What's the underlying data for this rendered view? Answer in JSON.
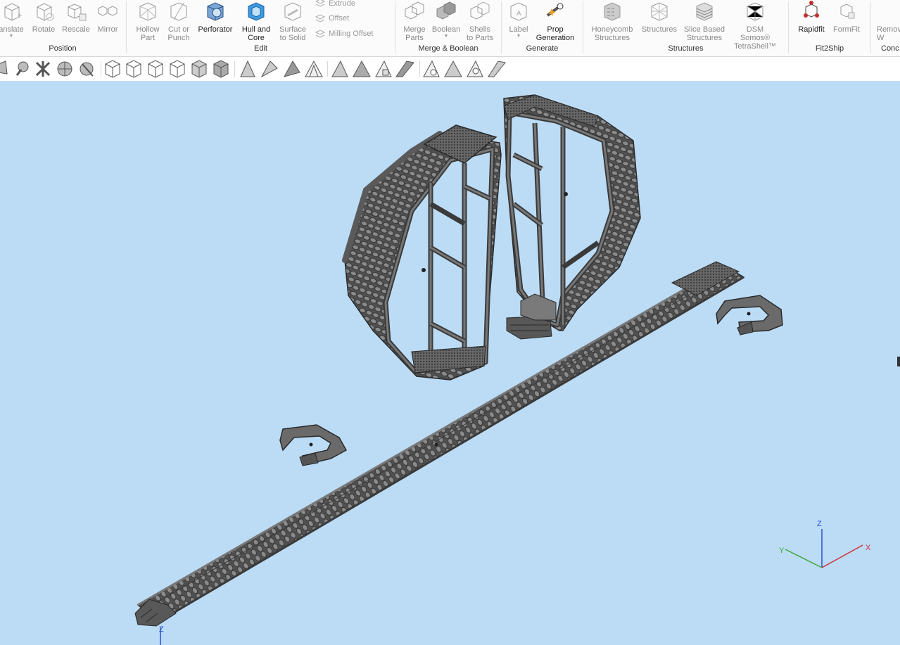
{
  "ribbon": {
    "groups": [
      {
        "label": "Position",
        "buttons": [
          {
            "label": "anslate",
            "dropdown": true
          },
          {
            "label": "Rotate"
          },
          {
            "label": "Rescale"
          },
          {
            "label": "Mirror"
          }
        ]
      },
      {
        "label": "Edit",
        "buttons": [
          {
            "label": "Hollow\nPart"
          },
          {
            "label": "Cut or\nPunch"
          },
          {
            "label": "Perforator"
          },
          {
            "label": "Hull and\nCore"
          },
          {
            "label": "Surface\nto Solid"
          }
        ],
        "small": [
          "Extrude",
          "Offset",
          "Milling Offset"
        ]
      },
      {
        "label": "Merge & Boolean",
        "buttons": [
          {
            "label": "Merge\nParts"
          },
          {
            "label": "Boolean",
            "dropdown": true
          },
          {
            "label": "Shells\nto Parts"
          }
        ]
      },
      {
        "label": "Generate",
        "buttons": [
          {
            "label": "Label",
            "dropdown": true
          },
          {
            "label": "Prop\nGeneration"
          }
        ]
      },
      {
        "label": "Structures",
        "buttons": [
          {
            "label": "Honeycomb\nStructures"
          },
          {
            "label": "Structures"
          },
          {
            "label": "Slice Based\nStructures"
          },
          {
            "label": "DSM Somos®\nTetraShell™"
          }
        ]
      },
      {
        "label": "Fit2Ship",
        "buttons": [
          {
            "label": "Rapidfit"
          },
          {
            "label": "FormFit"
          }
        ]
      },
      {
        "label": "Conc",
        "buttons": [
          {
            "label": "Remov\nW"
          }
        ]
      }
    ]
  },
  "axes": {
    "x": "X",
    "y": "Y",
    "z": "Z",
    "origin_z": "Z"
  },
  "colors": {
    "viewport": "#bcdcf6",
    "part": "#5f5f5f",
    "part_dark": "#3a3a3a",
    "x_axis": "#d0303a",
    "y_axis": "#3fa83f",
    "z_axis": "#2a4fd0"
  }
}
